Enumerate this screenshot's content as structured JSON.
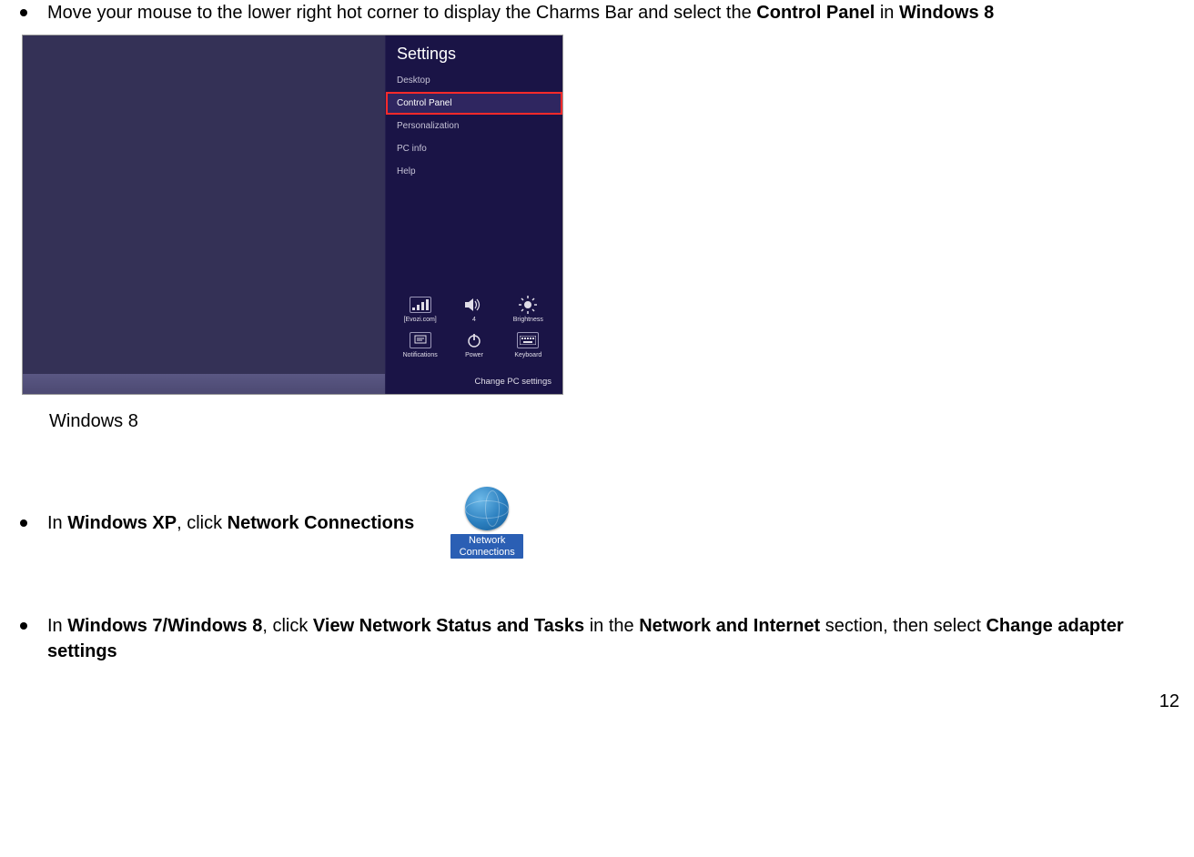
{
  "bullets": {
    "b1_pre": "Move your mouse to the lower right hot corner to display the Charms Bar and select the ",
    "b1_bold1": "Control Panel",
    "b1_mid": " in ",
    "b1_bold2": "Windows 8",
    "b2_pre": "In ",
    "b2_bold1": "Windows XP",
    "b2_mid": ", click ",
    "b2_bold2": "Network Connections",
    "b3_pre": "In ",
    "b3_bold1": "Windows 7/Windows 8",
    "b3_mid1": ", click ",
    "b3_bold2": "View Network Status and Tasks",
    "b3_mid2": " in the ",
    "b3_bold3": "Network and Internet",
    "b3_mid3": " section, then select ",
    "b3_bold4": "Change adapter settings"
  },
  "charm": {
    "title": "Settings",
    "items": [
      "Desktop",
      "Control Panel",
      "Personalization",
      "PC info",
      "Help"
    ],
    "tiles_row1": [
      {
        "label": "[Evozi.com]",
        "icon": "sig"
      },
      {
        "label": "4",
        "icon": "vol"
      },
      {
        "label": "Brightness",
        "icon": "sun"
      }
    ],
    "tiles_row2": [
      {
        "label": "Notifications",
        "icon": "notif"
      },
      {
        "label": "Power",
        "icon": "power"
      },
      {
        "label": "Keyboard",
        "icon": "kbd"
      }
    ],
    "footer": "Change PC settings"
  },
  "caption": "Windows 8",
  "xp_icon_label": "Network Connections",
  "page_number": "12"
}
